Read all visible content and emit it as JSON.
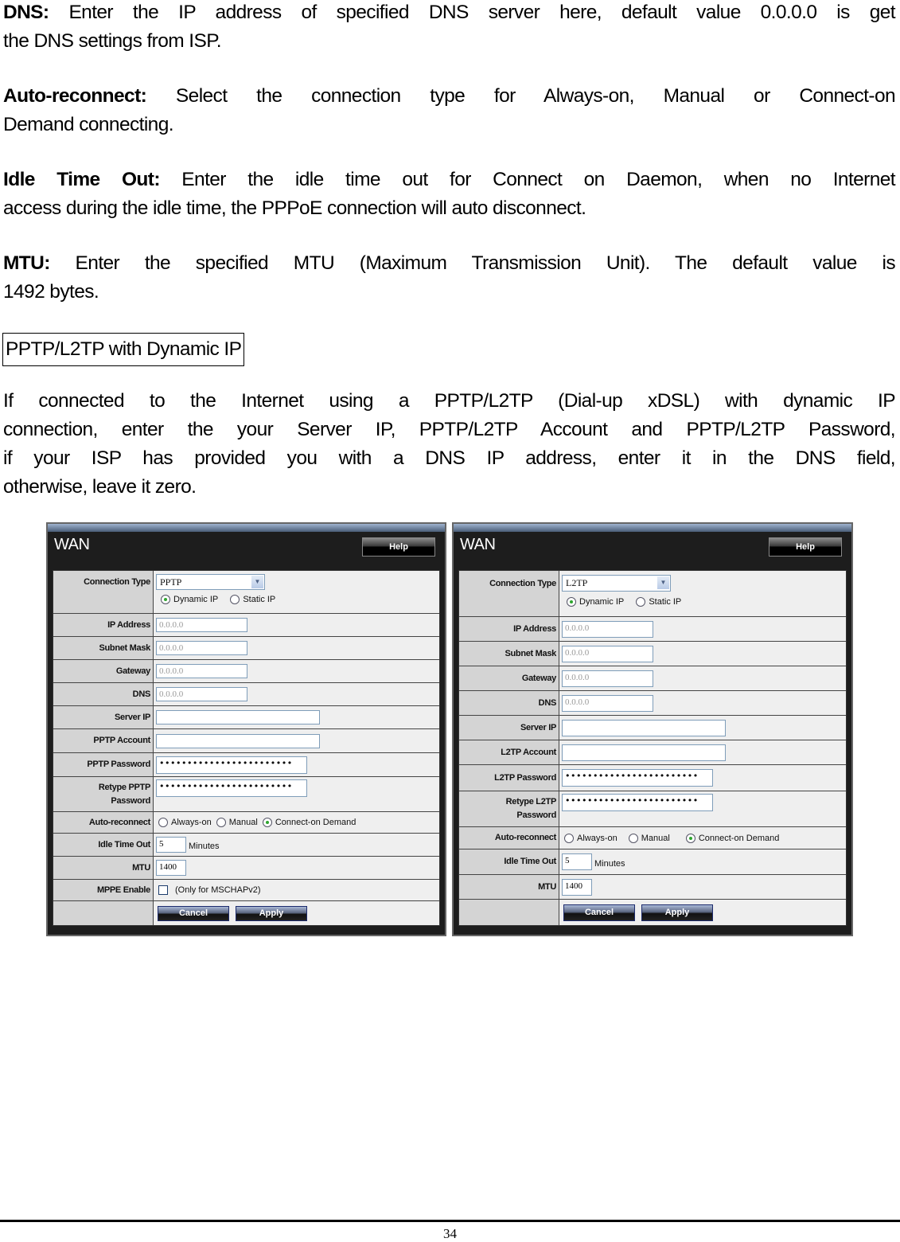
{
  "doc": {
    "paragraphs": [
      {
        "term": "DNS:",
        "lines": [
          "Enter the IP address of specified DNS server here, default value 0.0.0.0 is get",
          "the DNS settings from ISP."
        ]
      },
      {
        "term": "Auto-reconnect:",
        "lines": [
          "Select the connection type for Always-on, Manual or Connect-on",
          "Demand connecting."
        ]
      },
      {
        "term": "Idle Time Out:",
        "lines": [
          "Enter the idle time out for Connect on Daemon, when no Internet",
          "access during the idle time, the PPPoE connection will auto disconnect."
        ]
      },
      {
        "term": "MTU:",
        "lines": [
          "Enter the specified MTU (Maximum Transmission Unit). The default value is",
          "1492 bytes."
        ]
      }
    ],
    "section_heading": "PPTP/L2TP with Dynamic IP",
    "intro_lines": [
      "If connected to the Internet using a PPTP/L2TP (Dial-up xDSL) with dynamic IP",
      "connection, enter the your Server IP, PPTP/L2TP Account and PPTP/L2TP Password,",
      "if your ISP has provided you with a DNS IP address, enter it in the DNS field,",
      "otherwise, leave it zero."
    ],
    "page_number": "34"
  },
  "panels": [
    {
      "title": "WAN",
      "help_label": "Help",
      "connection_type_label": "Connection Type",
      "connection_type_value": "PPTP",
      "ip_mode_options": [
        {
          "label": "Dynamic IP",
          "selected": true
        },
        {
          "label": "Static IP",
          "selected": false
        }
      ],
      "ip_address_label": "IP Address",
      "ip_address_value": "0.0.0.0",
      "subnet_mask_label": "Subnet Mask",
      "subnet_mask_value": "0.0.0.0",
      "gateway_label": "Gateway",
      "gateway_value": "0.0.0.0",
      "dns_label": "DNS",
      "dns_value": "0.0.0.0",
      "server_ip_label": "Server IP",
      "server_ip_value": "",
      "account_label": "PPTP Account",
      "account_value": "",
      "password_label": "PPTP Password",
      "password_value": "••••••••••••••••••••••••",
      "retype_label_1": "Retype PPTP",
      "retype_label_2": "Password",
      "retype_value": "••••••••••••••••••••••••",
      "auto_reconnect_label": "Auto-reconnect",
      "auto_reconnect_options": [
        {
          "label": "Always-on",
          "selected": false
        },
        {
          "label": "Manual",
          "selected": false
        },
        {
          "label": "Connect-on Demand",
          "selected": true
        }
      ],
      "idle_label": "Idle Time Out",
      "idle_value": "5",
      "idle_unit": "Minutes",
      "mtu_label": "MTU",
      "mtu_value": "1400",
      "mppe_label": "MPPE Enable",
      "mppe_checked": false,
      "mppe_note": "(Only for MSCHAPv2)",
      "cancel_label": "Cancel",
      "apply_label": "Apply"
    },
    {
      "title": "WAN",
      "help_label": "Help",
      "connection_type_label": "Connection Type",
      "connection_type_value": "L2TP",
      "ip_mode_options": [
        {
          "label": "Dynamic IP",
          "selected": true
        },
        {
          "label": "Static IP",
          "selected": false
        }
      ],
      "ip_address_label": "IP Address",
      "ip_address_value": "0.0.0.0",
      "subnet_mask_label": "Subnet Mask",
      "subnet_mask_value": "0.0.0.0",
      "gateway_label": "Gateway",
      "gateway_value": "0.0.0.0",
      "dns_label": "DNS",
      "dns_value": "0.0.0.0",
      "server_ip_label": "Server IP",
      "server_ip_value": "",
      "account_label": "L2TP Account",
      "account_value": "",
      "password_label": "L2TP Password",
      "password_value": "••••••••••••••••••••••••",
      "retype_label_1": "Retype L2TP",
      "retype_label_2": "Password",
      "retype_value": "••••••••••••••••••••••••",
      "auto_reconnect_label": "Auto-reconnect",
      "auto_reconnect_options": [
        {
          "label": "Always-on",
          "selected": false
        },
        {
          "label": "Manual",
          "selected": false
        },
        {
          "label": "Connect-on Demand",
          "selected": true
        }
      ],
      "idle_label": "Idle Time Out",
      "idle_value": "5",
      "idle_unit": "Minutes",
      "mtu_label": "MTU",
      "mtu_value": "1400",
      "cancel_label": "Cancel",
      "apply_label": "Apply"
    }
  ]
}
